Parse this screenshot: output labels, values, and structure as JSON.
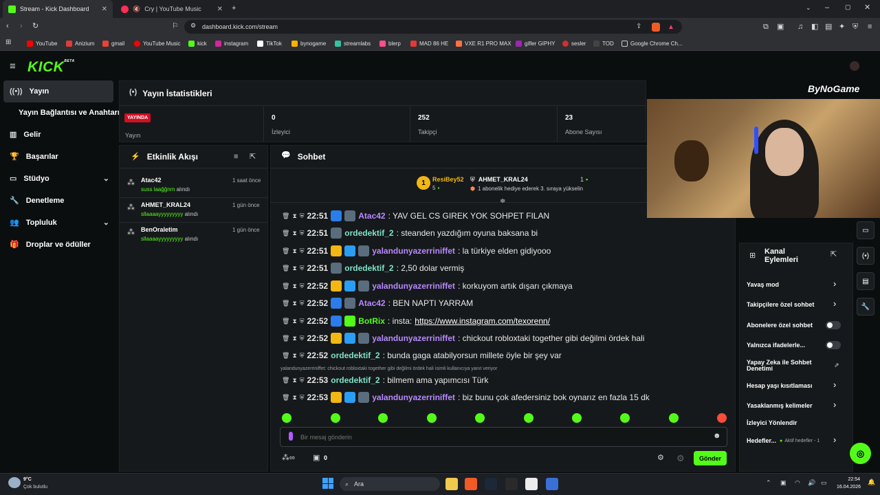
{
  "browser": {
    "tabs": [
      {
        "title": "Stream - Kick Dashboard",
        "color": "#53fc18"
      },
      {
        "title": "Cry | YouTube Music",
        "color": "#ff2d55"
      }
    ],
    "url": "dashboard.kick.com/stream",
    "bookmarks": [
      {
        "label": "YouTube",
        "color": "#ff0000"
      },
      {
        "label": "Anizium",
        "color": "#e23b3b"
      },
      {
        "label": "gmail",
        "color": "#ea4335"
      },
      {
        "label": "YouTube Music",
        "color": "#ff0000"
      },
      {
        "label": "kick",
        "color": "#53fc18"
      },
      {
        "label": "instagram",
        "color": "#d6249f"
      },
      {
        "label": "TikTok",
        "color": "#ffffff"
      },
      {
        "label": "bynogame",
        "color": "#ffb300"
      },
      {
        "label": "streamlabs",
        "color": "#31c3a2"
      },
      {
        "label": "blerp",
        "color": "#ff4f8b"
      },
      {
        "label": "MAD 86 HE",
        "color": "#e53935"
      },
      {
        "label": "VXE R1 PRO MAX",
        "color": "#ff7043"
      },
      {
        "label": "gifler GIPHY",
        "color": "#9c27b0"
      },
      {
        "label": "sesler",
        "color": "#d32f2f"
      },
      {
        "label": "TOD",
        "color": "#222222"
      },
      {
        "label": "Google Chrome Ch...",
        "color": "#888888"
      }
    ]
  },
  "app": {
    "logo": "KICK",
    "logo_sup": "BETA",
    "nav": [
      {
        "label": "Yayın",
        "icon": "broadcast-icon"
      },
      {
        "label": "Yayın Bağlantısı ve Anahtarı",
        "icon": ""
      },
      {
        "label": "Gelir",
        "icon": "revenue-icon"
      },
      {
        "label": "Başarılar",
        "icon": "trophy-icon"
      },
      {
        "label": "Stüdyo",
        "icon": "studio-icon"
      },
      {
        "label": "Denetleme",
        "icon": "wrench-icon"
      },
      {
        "label": "Topluluk",
        "icon": "community-icon"
      },
      {
        "label": "Droplar ve ödüller",
        "icon": "drops-icon"
      }
    ],
    "stats": {
      "title": "Yayın İstatistikleri",
      "live_badge": "YAYINDA",
      "live_label": "Yayın",
      "items": [
        {
          "value": "0",
          "label": "İzleyici"
        },
        {
          "value": "252",
          "label": "Takipçi"
        },
        {
          "value": "23",
          "label": "Abone Sayısı"
        }
      ]
    },
    "events": {
      "title": "Etkinlik Akışı",
      "items": [
        {
          "name": "Atac42",
          "gift": "suss laağğnm",
          "suffix": "alındı",
          "time": "1 saat önce"
        },
        {
          "name": "AHMET_KRAL24",
          "gift": "sllaaaayyyyyyyyy",
          "suffix": "alındı",
          "time": "1 gün önce"
        },
        {
          "name": "BenOraletim",
          "gift": "sllaaaayyyyyyyyy",
          "suffix": "alındı",
          "time": "1 gün önce"
        }
      ]
    },
    "chat": {
      "title": "Sohbet",
      "pinned": {
        "rank": "1",
        "user1": "ResiBey52",
        "user1_count": "5",
        "user2": "AHMET_KRAL24",
        "user2_count": "1",
        "note": "1 abonelik hediye ederek 3. sıraya yükselin"
      },
      "messages": [
        {
          "time": "22:51",
          "user": "Atac42",
          "color": "#b889ff",
          "text": ": YAV GEL CS GIREK YOK SOHPET FILAN",
          "badges": [
            "#2b7de9",
            "#5a6d7e"
          ]
        },
        {
          "time": "22:51",
          "user": "ordedektif_2",
          "color": "#7fe3c9",
          "text": ": steanden yazdığım oyuna baksana bi",
          "badges": [
            "#5a6d7e"
          ]
        },
        {
          "time": "22:51",
          "user": "yalandunyazerriniffet",
          "color": "#b889ff",
          "text": ": la türkiye elden gidiyooo",
          "badges": [
            "#f2b713",
            "#2a9df4",
            "#5a6d7e"
          ]
        },
        {
          "time": "22:51",
          "user": "ordedektif_2",
          "color": "#7fe3c9",
          "text": ": 2,50 dolar vermiş",
          "badges": [
            "#5a6d7e"
          ]
        },
        {
          "time": "22:52",
          "user": "yalandunyazerriniffet",
          "color": "#b889ff",
          "text": ": korkuyom artık dışarı çıkmaya",
          "badges": [
            "#f2b713",
            "#2a9df4",
            "#5a6d7e"
          ]
        },
        {
          "time": "22:52",
          "user": "Atac42",
          "color": "#b889ff",
          "text": ": BEN NAPTI YARRAM",
          "badges": [
            "#2b7de9",
            "#5a6d7e"
          ]
        },
        {
          "time": "22:52",
          "user": "BotRix",
          "color": "#53fc18",
          "text": ": insta: ",
          "link": "https://www.instagram.com/texorenn/",
          "badges": [
            "#2b7de9",
            "#53fc18"
          ]
        },
        {
          "time": "22:52",
          "user": "yalandunyazerriniffet",
          "color": "#b889ff",
          "text": ": chickout robloxtaki together gibi değilmi ördek hali",
          "badges": [
            "#f2b713",
            "#2a9df4",
            "#5a6d7e"
          ]
        },
        {
          "time": "22:52",
          "user": "ordedektif_2",
          "color": "#7fe3c9",
          "text": ": bunda gaga atabilyorsun millete öyle bir şey var",
          "badges": []
        },
        {
          "time": "22:53",
          "user": "ordedektif_2",
          "color": "#7fe3c9",
          "text": ": bilmem ama yapımcısı Türk",
          "badges": [],
          "reply": "yalandunyazerriniffet: chickout robloxtaki together gibi değilmi ördek hali isimli kullanıcıya yanıt veriyor"
        },
        {
          "time": "22:53",
          "user": "yalandunyazerriniffet",
          "color": "#b889ff",
          "text": ": biz bunu çok afedersiniz bok oynarız en fazla 15 dk",
          "badges": [
            "#f2b713",
            "#2a9df4",
            "#5a6d7e"
          ]
        }
      ],
      "input_placeholder": "Bir mesaj gönderin",
      "points": "0",
      "send_label": "Gönder"
    },
    "overlay_brand": "ByNoGame",
    "channel_actions": {
      "title": "Kanal Eylemleri",
      "items": [
        {
          "label": "Yavaş mod",
          "control": "chevron"
        },
        {
          "label": "Takipçilere özel sohbet",
          "control": "chevron"
        },
        {
          "label": "Abonelere özel sohbet",
          "control": "toggle"
        },
        {
          "label": "Yalnızca ifadelerle...",
          "control": "toggle"
        },
        {
          "label": "Yapay Zeka ile Sohbet Denetimi",
          "control": "external"
        },
        {
          "label": "Hesap yaşı kısıtlaması",
          "control": "chevron"
        },
        {
          "label": "Yasaklanmış kelimeler",
          "control": "chevron"
        },
        {
          "label": "İzleyici Yönlendir",
          "control": "none"
        },
        {
          "label": "Hedefler...",
          "control": "chevron",
          "extra": "Aktif hedefler - 1"
        }
      ]
    }
  },
  "taskbar": {
    "weather_temp": "9°C",
    "weather_desc": "Çok bulutlu",
    "search_label": "Ara",
    "time": "22:54",
    "date": "16.04.2026"
  }
}
